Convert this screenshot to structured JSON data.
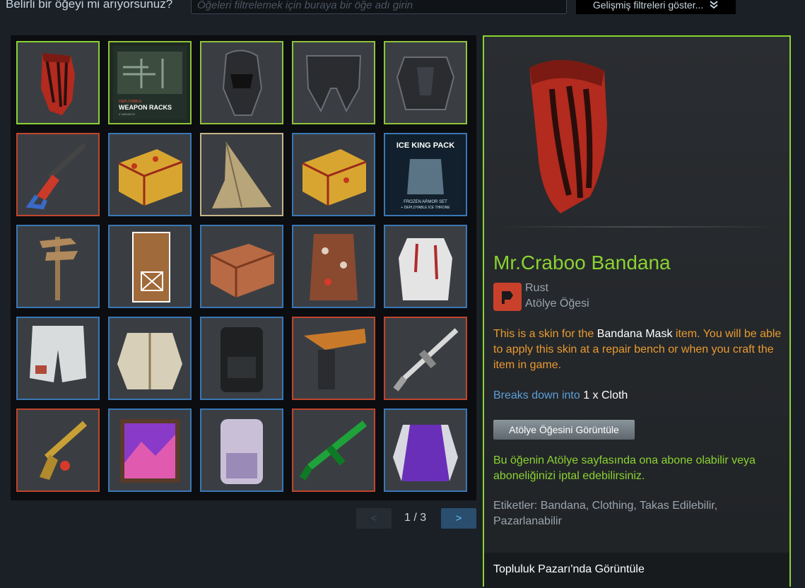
{
  "search": {
    "label": "Belirli bir öğeyi mi arıyorsunuz?",
    "placeholder": "Öğeleri filtrelemek için buraya bir öğe adı girin",
    "advanced_label": "Gelişmiş filtreleri göster..."
  },
  "grid": {
    "items": [
      {
        "name": "bandana-mask",
        "border": "sel"
      },
      {
        "name": "weapon-racks-pack",
        "border": "green"
      },
      {
        "name": "ice-helmet",
        "border": "green"
      },
      {
        "name": "ice-leg-armor",
        "border": "green"
      },
      {
        "name": "ice-chest-armor",
        "border": "green"
      },
      {
        "name": "salvaged-rifle",
        "border": "red"
      },
      {
        "name": "painted-large-box",
        "border": "blue"
      },
      {
        "name": "burlap-cloth",
        "border": "tan"
      },
      {
        "name": "painted-large-box-2",
        "border": "blue"
      },
      {
        "name": "ice-king-pack",
        "border": "blue"
      },
      {
        "name": "wooden-signpost",
        "border": "blue"
      },
      {
        "name": "gingerbread-door",
        "border": "blue"
      },
      {
        "name": "wooden-box",
        "border": "blue"
      },
      {
        "name": "festive-sleeping-bag",
        "border": "blue"
      },
      {
        "name": "bloody-vest",
        "border": "blue"
      },
      {
        "name": "patched-shorts",
        "border": "blue"
      },
      {
        "name": "fur-jacket",
        "border": "blue"
      },
      {
        "name": "tactical-backpack",
        "border": "blue"
      },
      {
        "name": "orange-pistol",
        "border": "red"
      },
      {
        "name": "white-thompson",
        "border": "red"
      },
      {
        "name": "gold-pistol",
        "border": "red"
      },
      {
        "name": "purple-painting",
        "border": "blue"
      },
      {
        "name": "rivals-backpack",
        "border": "blue"
      },
      {
        "name": "green-smg",
        "border": "red"
      },
      {
        "name": "varsity-jacket",
        "border": "blue"
      }
    ],
    "ice_king_title": "ICE KING PACK",
    "ice_king_sub": "FROZEN ARMOR SET",
    "ice_king_sub2": "+ DEPLOYABLE ICE THRONE",
    "weapon_racks_tag": "DEPLOYABLE",
    "weapon_racks_title": "WEAPON RACKS",
    "weapon_racks_sub": "4 VARIANTS"
  },
  "pager": {
    "prev": "<",
    "next": ">",
    "text": "1 / 3"
  },
  "detail": {
    "title": "Mr.Craboo Bandana",
    "game": "Rust",
    "type": "Atölye Öğesi",
    "desc_pre": "This is a skin for the ",
    "desc_item": "Bandana Mask",
    "desc_post": " item. You will be able to apply this skin at a repair bench or when you craft the item in game.",
    "breaks_label": "Breaks down into ",
    "breaks_value": "1 x Cloth",
    "workshop_button": "Atölye Öğesini Görüntüle",
    "subscribe_note": "Bu öğenin Atölye sayfasında ona abone olabilir veya aboneliğinizi iptal edebilirsiniz.",
    "tags": "Etiketler: Bandana, Clothing, Takas Edilebilir, Pazarlanabilir",
    "market_link": "Topluluk Pazarı'nda Görüntüle"
  },
  "colors": {
    "accent": "#8ad332",
    "desc": "#e99a2f",
    "breaks": "#5c9fd8"
  }
}
